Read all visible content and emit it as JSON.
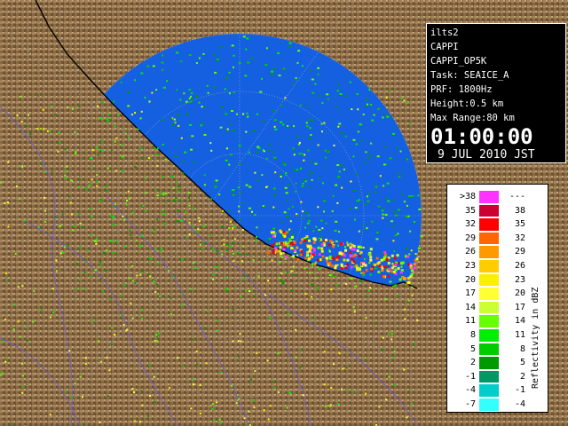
{
  "info": {
    "station": "ilts2",
    "product": "CAPPI",
    "product_id": "CAPPI_OP5K",
    "task": "Task: SEAICE_A",
    "prf": "PRF: 1800Hz",
    "height": "Height:0.5 km",
    "max_range": "Max Range:80 km",
    "time": "01:00:00",
    "date": "9 JUL 2010 JST"
  },
  "legend": {
    "title": "Reflectivity in dBZ",
    "rows": [
      {
        "lo": ">38",
        "hi": "---",
        "color": "#ff33ff"
      },
      {
        "lo": "35",
        "hi": "38",
        "color": "#cc0033"
      },
      {
        "lo": "32",
        "hi": "35",
        "color": "#ff0000"
      },
      {
        "lo": "29",
        "hi": "32",
        "color": "#ff6600"
      },
      {
        "lo": "26",
        "hi": "29",
        "color": "#ff9900"
      },
      {
        "lo": "23",
        "hi": "26",
        "color": "#ffcc00"
      },
      {
        "lo": "20",
        "hi": "23",
        "color": "#ffee00"
      },
      {
        "lo": "17",
        "hi": "20",
        "color": "#ffff33"
      },
      {
        "lo": "14",
        "hi": "17",
        "color": "#ccff33"
      },
      {
        "lo": "11",
        "hi": "14",
        "color": "#66ff00"
      },
      {
        "lo": "8",
        "hi": "11",
        "color": "#00ee00"
      },
      {
        "lo": "5",
        "hi": "8",
        "color": "#00cc00"
      },
      {
        "lo": "2",
        "hi": "5",
        "color": "#009900"
      },
      {
        "lo": "-1",
        "hi": "2",
        "color": "#009966"
      },
      {
        "lo": "-4",
        "hi": "-1",
        "color": "#00cccc"
      },
      {
        "lo": "-7",
        "hi": "-4",
        "color": "#33ffff"
      }
    ]
  },
  "colors": {
    "sea": "#1460e0",
    "land": "#8a6a42",
    "range_ring": "#aaaaaa"
  }
}
